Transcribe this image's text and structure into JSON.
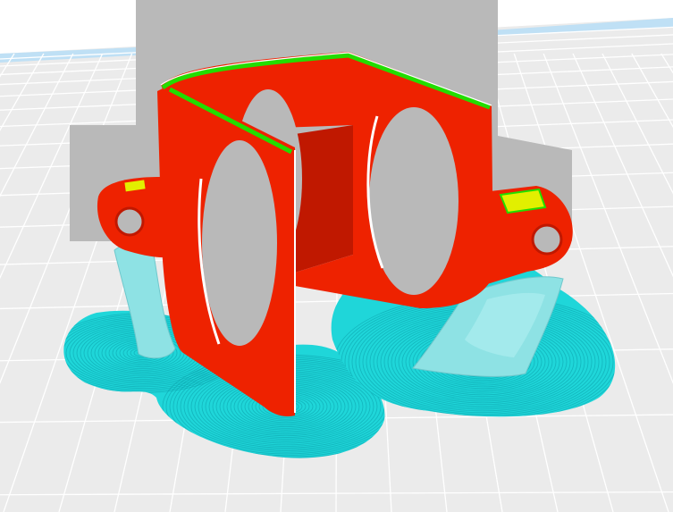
{
  "viewport": {
    "background_color": "#ffffff",
    "build_plate_color": "#ebebeb",
    "grid_line_color": "#ffffff",
    "build_volume_color": "#b9b9b9",
    "far_edge_color": "#bfe0f5"
  },
  "model": {
    "wall_color": "#ee2200",
    "wall_dark_color": "#c01800",
    "top_skin_color": "#22dd00",
    "infill_color": "#e2ef00",
    "inner_highlight_color": "#ffffff"
  },
  "support": {
    "brim_color": "#1fd6d9",
    "brim_ring_color": "#0a9aa5",
    "support_color": "#8ee2e4"
  }
}
